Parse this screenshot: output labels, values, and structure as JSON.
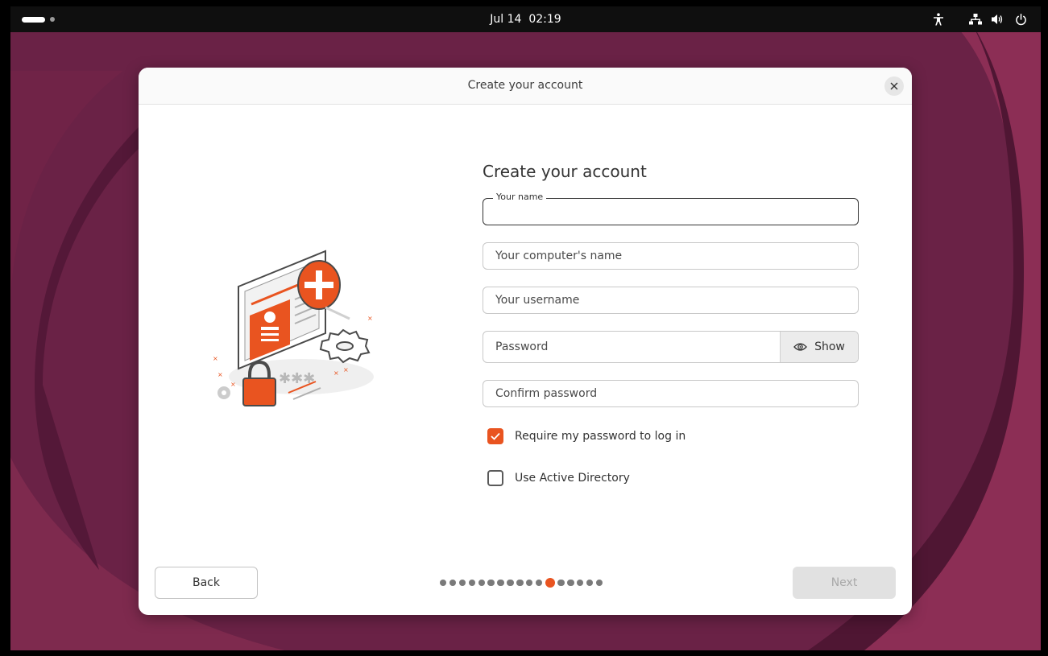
{
  "topbar": {
    "clock": "Jul 14  02:19",
    "icons": [
      "activities-icon",
      "accessibility-icon",
      "network-wired-icon",
      "volume-icon",
      "power-icon"
    ]
  },
  "dialog": {
    "title": "Create your account",
    "close_icon": "close-icon"
  },
  "form": {
    "heading": "Create your account",
    "name_label": "Your name",
    "name_value": "",
    "computer_name_placeholder": "Your computer's name",
    "username_placeholder": "Your username",
    "password_placeholder": "Password",
    "show_label": "Show",
    "confirm_password_placeholder": "Confirm password",
    "require_password_label": "Require my password to log in",
    "require_password_checked": true,
    "active_directory_label": "Use Active Directory",
    "active_directory_checked": false
  },
  "nav": {
    "back_label": "Back",
    "next_label": "Next",
    "next_enabled": false,
    "total_steps": 17,
    "current_step": 12
  },
  "colors": {
    "accent": "#e95420",
    "wallpaper": "#6a2246",
    "topbar": "#0f0f0f"
  }
}
